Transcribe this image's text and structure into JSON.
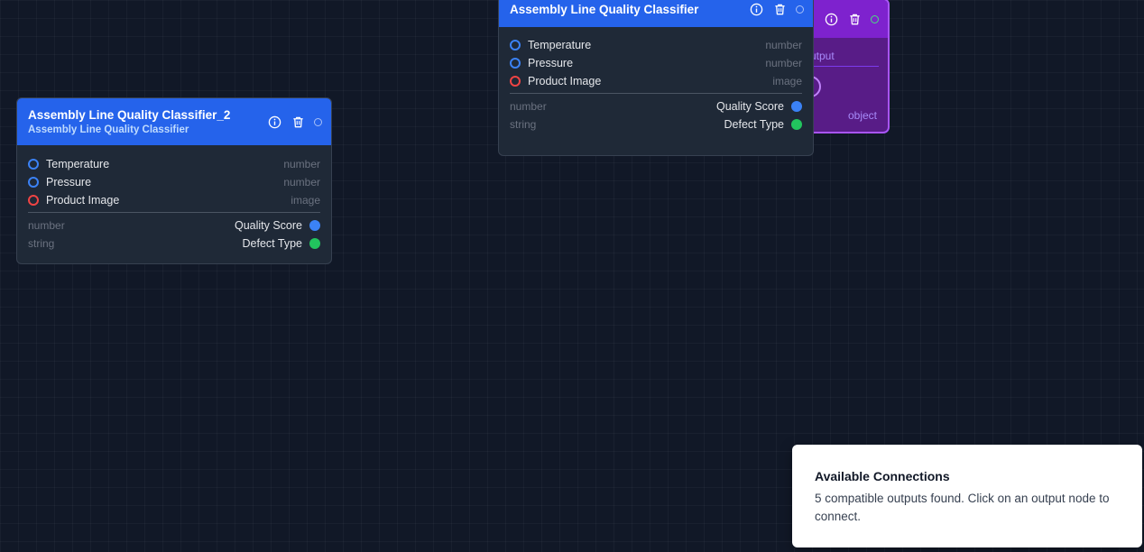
{
  "colors": {
    "canvas_bg": "#111827",
    "node_header": "#2563eb",
    "port_number": "#3b82f6",
    "port_image": "#ef4444",
    "port_string": "#22c55e",
    "output_node": "#7e22ce"
  },
  "nodes": [
    {
      "title": "Assembly Line Quality Classifier_2",
      "subtitle": "Assembly Line Quality Classifier",
      "icons": [
        "info-icon",
        "trash-icon",
        "status-dot"
      ],
      "inputs": [
        {
          "label": "Temperature",
          "type": "number"
        },
        {
          "label": "Pressure",
          "type": "number"
        },
        {
          "label": "Product Image",
          "type": "image"
        }
      ],
      "outputs": [
        {
          "label": "Quality Score",
          "type": "number"
        },
        {
          "label": "Defect Type",
          "type": "string"
        }
      ]
    },
    {
      "title": "Assembly Line Quality Classifier",
      "icons": [
        "info-icon",
        "trash-icon",
        "status-dot"
      ],
      "inputs": [
        {
          "label": "Temperature",
          "type": "number"
        },
        {
          "label": "Pressure",
          "type": "number"
        },
        {
          "label": "Product Image",
          "type": "image"
        }
      ],
      "outputs": [
        {
          "label": "Quality Score",
          "type": "number"
        },
        {
          "label": "Defect Type",
          "type": "string"
        }
      ]
    }
  ],
  "output_node": {
    "label": "utput",
    "type": "object",
    "icons": [
      "info-icon",
      "trash-icon",
      "status-dot"
    ]
  },
  "toast": {
    "title": "Available Connections",
    "message": "5 compatible outputs found. Click on an output node to connect."
  }
}
